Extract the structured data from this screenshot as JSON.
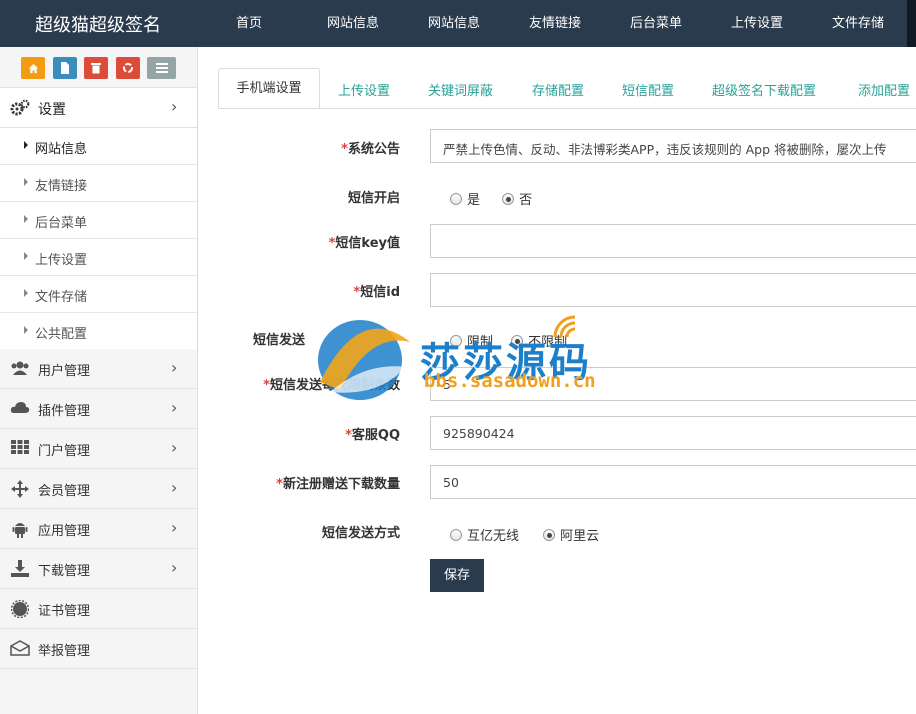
{
  "brand": "超级猫超级签名",
  "topnav": [
    "首页",
    "网站信息",
    "网站信息",
    "友情链接",
    "后台菜单",
    "上传设置",
    "文件存储"
  ],
  "sidebar": {
    "quick_buttons": [
      {
        "icon": "home-icon",
        "color": "#f39c12"
      },
      {
        "icon": "file-icon",
        "color": "#3c8dbc"
      },
      {
        "icon": "trash-icon",
        "color": "#dd4b39"
      },
      {
        "icon": "recycle-icon",
        "color": "#dd4b39"
      },
      {
        "icon": "list-icon",
        "color": "#95a5a6"
      }
    ],
    "settings": {
      "label": "设置",
      "icon": "gears-icon"
    },
    "sub_items": [
      "网站信息",
      "友情链接",
      "后台菜单",
      "上传设置",
      "文件存储",
      "公共配置"
    ],
    "active_sub": "网站信息",
    "groups": [
      {
        "label": "用户管理",
        "icon": "users-icon"
      },
      {
        "label": "插件管理",
        "icon": "cloud-icon"
      },
      {
        "label": "门户管理",
        "icon": "grid-icon"
      },
      {
        "label": "会员管理",
        "icon": "move-icon"
      },
      {
        "label": "应用管理",
        "icon": "android-icon"
      },
      {
        "label": "下载管理",
        "icon": "download-icon"
      },
      {
        "label": "证书管理",
        "icon": "certificate-icon"
      },
      {
        "label": "举报管理",
        "icon": "envelope-icon"
      }
    ]
  },
  "tabs": [
    "手机端设置",
    "上传设置",
    "关键词屏蔽",
    "存储配置",
    "短信配置",
    "超级签名下载配置",
    "添加配置"
  ],
  "form": {
    "notice_label": "系统公告",
    "notice_value": "严禁上传色情、反动、非法博彩类APP，违反该规则的 App 将被删除，屡次上传",
    "sms_enable_label": "短信开启",
    "sms_enable_options": [
      "是",
      "否"
    ],
    "sms_enable_selected": "否",
    "sms_key_label": "短信key值",
    "sms_key_value": "",
    "sms_id_label": "短信id",
    "sms_id_value": "",
    "sms_limit_label": "短信发送",
    "sms_limit_options": [
      "限制",
      "不限制"
    ],
    "sms_limit_selected": "不限制",
    "sms_count_label": "短信发送每天限制条数",
    "sms_count_value": "5",
    "qq_label": "客服QQ",
    "qq_value": "925890424",
    "gift_label": "新注册赠送下载数量",
    "gift_value": "50",
    "sms_method_label": "短信发送方式",
    "sms_method_options": [
      "互亿无线",
      "阿里云"
    ],
    "sms_method_selected": "阿里云",
    "save_label": "保存"
  },
  "watermark": {
    "title": "莎莎源码",
    "url": "bbs.sasadown.cn"
  }
}
